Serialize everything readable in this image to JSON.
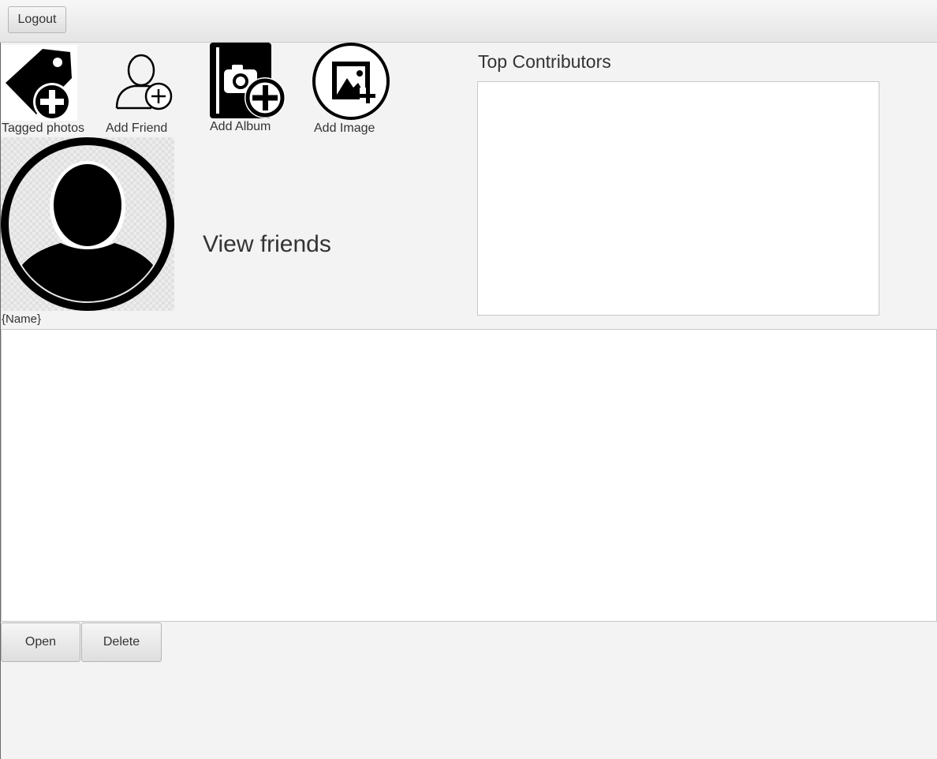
{
  "toolbar": {
    "logout_label": "Logout"
  },
  "actions": {
    "tagged_photos": {
      "label": "Tagged photos",
      "icon": "tag-plus-icon"
    },
    "add_friend": {
      "label": "Add Friend",
      "icon": "user-plus-icon"
    },
    "add_album": {
      "label": "Add Album",
      "icon": "album-plus-icon"
    },
    "add_image": {
      "label": "Add Image",
      "icon": "image-plus-icon"
    }
  },
  "profile": {
    "name": "{Name}",
    "view_friends_label": "View friends",
    "avatar_icon": "user-avatar-icon"
  },
  "top_contributors": {
    "title": "Top Contributors",
    "items": []
  },
  "albums": {
    "items": []
  },
  "bottom_buttons": {
    "open_label": "Open",
    "delete_label": "Delete"
  }
}
